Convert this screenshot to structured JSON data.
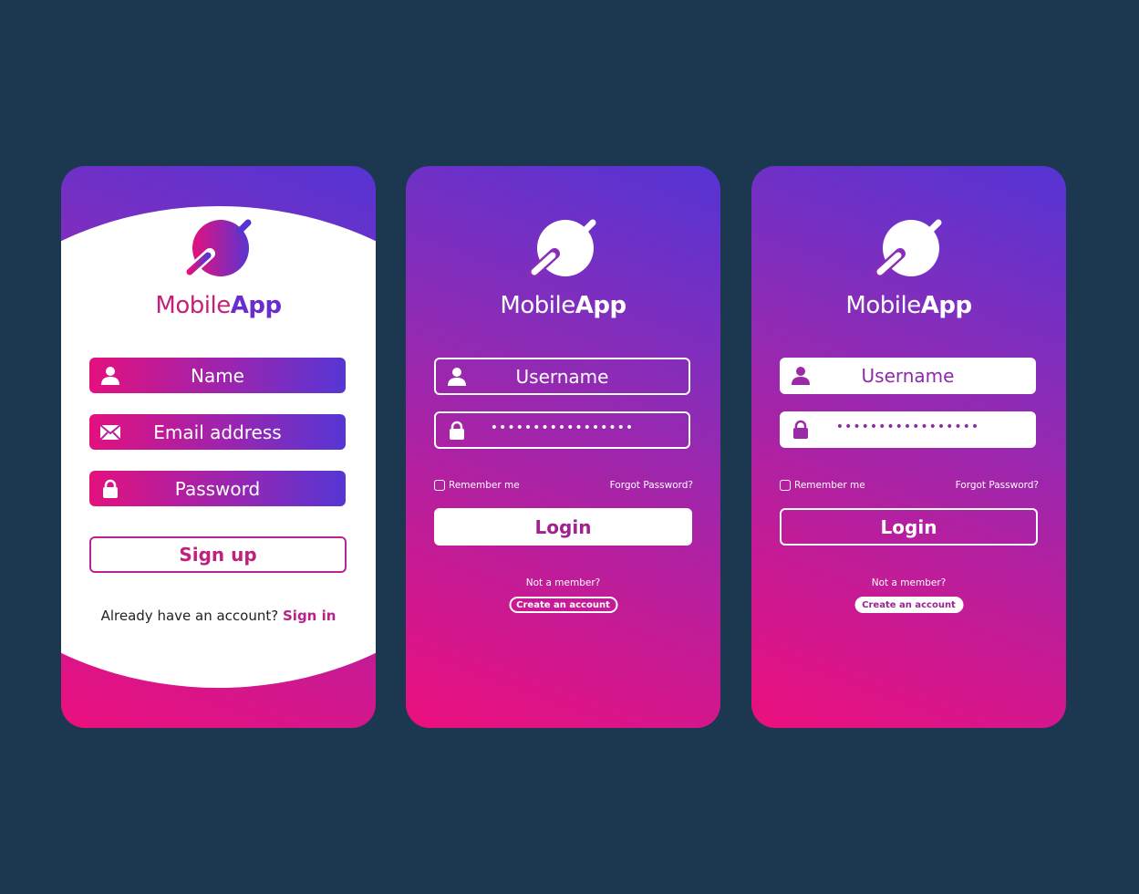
{
  "colors": {
    "background": "#1b3850",
    "gradient_start": "#5534d4",
    "gradient_end": "#ec0f7d",
    "accent_pink": "#c4217b",
    "accent_purple": "#6a2ccc"
  },
  "signup_screen": {
    "logo_icon": "planet-logo-icon",
    "brand": {
      "part1": "Mobile",
      "part2": "App"
    },
    "fields": [
      {
        "icon": "user-icon",
        "placeholder": "Name"
      },
      {
        "icon": "envelope-icon",
        "placeholder": "Email address"
      },
      {
        "icon": "lock-icon",
        "placeholder": "Password"
      }
    ],
    "signup_button": "Sign up",
    "already_text": "Already have an account?",
    "signin_link": "Sign in"
  },
  "login_screen_a": {
    "logo_icon": "planet-logo-icon",
    "brand": {
      "part1": "Mobile",
      "part2": "App"
    },
    "username_placeholder": "Username",
    "password_value": "•••••••••••••••••",
    "remember_label": "Remember me",
    "remember_checked": false,
    "forgot_link": "Forgot Password?",
    "login_button": "Login",
    "not_member": "Not a member?",
    "create_account": "Create an account"
  },
  "login_screen_b": {
    "logo_icon": "planet-logo-icon",
    "brand": {
      "part1": "Mobile",
      "part2": "App"
    },
    "username_placeholder": "Username",
    "password_value": "•••••••••••••••••",
    "remember_label": "Remember me",
    "remember_checked": false,
    "forgot_link": "Forgot Password?",
    "login_button": "Login",
    "not_member": "Not a member?",
    "create_account": "Create an account"
  }
}
